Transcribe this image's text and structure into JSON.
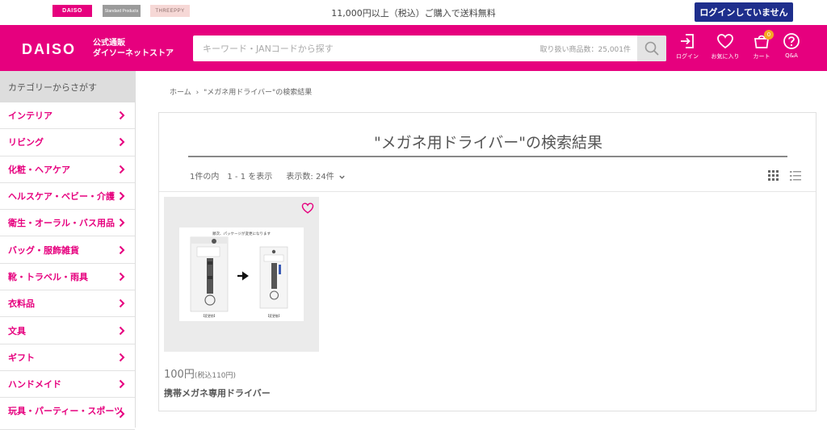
{
  "topbar": {
    "brands": [
      "DAISO",
      "Standard Products",
      "THREEPPY"
    ],
    "shipping_notice": "11,000円以上（税込）ご購入で送料無料",
    "login_button": "ログインしていません"
  },
  "header": {
    "logo": "DAISO",
    "logo_sub_line1": "公式通販",
    "logo_sub_line2": "ダイソーネットストア",
    "search": {
      "placeholder": "キーワード・JANコードから探す",
      "count_text": "取り扱い商品数：25,001件"
    },
    "icons": [
      {
        "name": "login-icon",
        "label": "ログイン"
      },
      {
        "name": "heart-icon",
        "label": "お気に入り"
      },
      {
        "name": "cart-icon",
        "label": "カート",
        "badge": "0"
      },
      {
        "name": "help-icon",
        "label": "Q&A"
      }
    ]
  },
  "sidebar": {
    "heading": "カテゴリーからさがす",
    "items": [
      "インテリア",
      "リビング",
      "化粧・ヘアケア",
      "ヘルスケア・ベビー・介護",
      "衛生・オーラル・バス用品",
      "バッグ・服飾雑貨",
      "靴・トラベル・雨具",
      "衣料品",
      "文具",
      "ギフト",
      "ハンドメイド",
      "玩具・パーティー・スポーツ"
    ]
  },
  "breadcrumb": {
    "home": "ホーム",
    "separator": "›",
    "current": "\"メガネ用ドライバー\"の検索結果"
  },
  "results": {
    "title": "\"メガネ用ドライバー\"の検索結果",
    "count_text": "1件の内　1 - 1 を表示",
    "per_page_text": "表示数: 24件"
  },
  "product": {
    "price": "100円",
    "price_tax": "(税込110円)",
    "name": "携帯メガネ専用ドライバー",
    "image_caption": "順次、パッケージが変更になります",
    "label_before": "【変更前】",
    "label_after": "【変更後】"
  },
  "colors": {
    "brand_pink": "#e6007e",
    "login_navy": "#1e2e8c",
    "badge_orange": "#f5a623"
  }
}
